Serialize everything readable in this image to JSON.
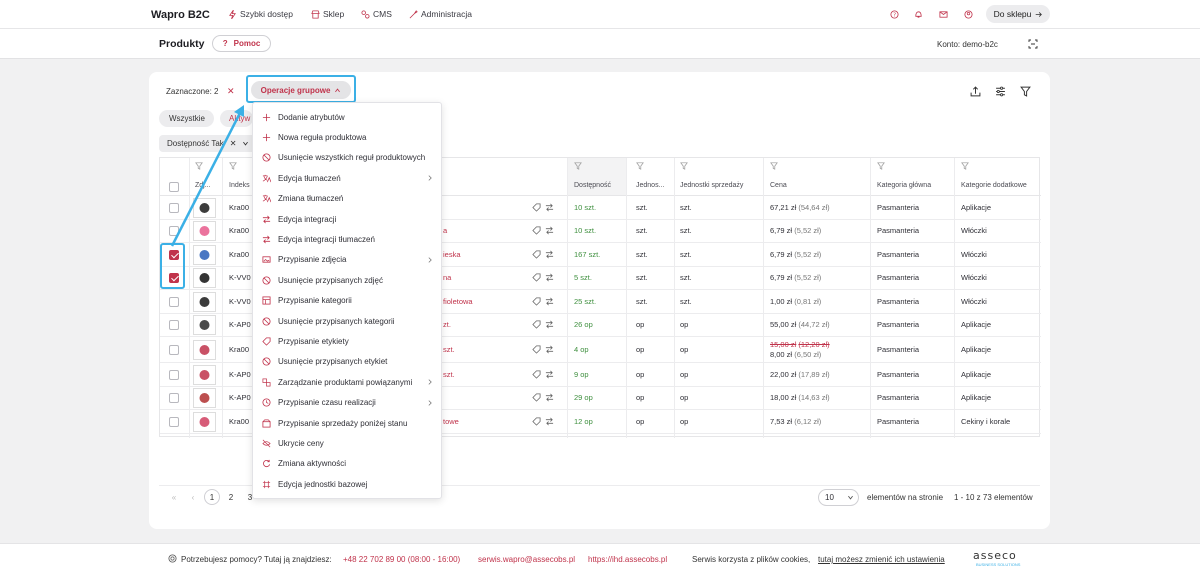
{
  "topbar": {
    "brand": "Wapro B2C",
    "nav": [
      {
        "label": "Szybki dostęp",
        "icon": "bolt-icon"
      },
      {
        "label": "Sklep",
        "icon": "store-icon"
      },
      {
        "label": "CMS",
        "icon": "cms-icon"
      },
      {
        "label": "Administracja",
        "icon": "wrench-icon"
      }
    ],
    "shop_button": "Do sklepu"
  },
  "subbar": {
    "title": "Produkty",
    "help_label": "Pomoc",
    "account": "Konto: demo-b2c"
  },
  "toolbar": {
    "selected": "Zaznaczone: 2",
    "group_ops": "Operacje grupowe"
  },
  "chips": {
    "all": "Wszystkie",
    "active_partial": "Aktyw"
  },
  "filter_chip": "Dostępność Tak",
  "columns": {
    "img": "Zdj...",
    "index": "Indeks",
    "availability": "Dostępność",
    "unit": "Jednos...",
    "sales_unit": "Jednostki sprzedaży",
    "price": "Cena",
    "main_category": "Kategoria główna",
    "extra_categories": "Kategorie dodatkowe"
  },
  "rows": [
    {
      "index": "Kra00",
      "name_tail": "",
      "avail": "10 szt.",
      "unit": "szt.",
      "sunit": "szt.",
      "price": "67,21 zł",
      "net": "(54,64 zł)",
      "old_price": "",
      "old_net": "",
      "main": "Pasmanteria",
      "extra": "Aplikacje",
      "checked": false
    },
    {
      "index": "Kra00",
      "name_tail": "a",
      "avail": "10 szt.",
      "unit": "szt.",
      "sunit": "szt.",
      "price": "6,79 zł",
      "net": "(5,52 zł)",
      "old_price": "",
      "old_net": "",
      "main": "Pasmanteria",
      "extra": "Włóczki",
      "checked": false
    },
    {
      "index": "Kra00",
      "name_tail": "ieska",
      "avail": "167 szt.",
      "unit": "szt.",
      "sunit": "szt.",
      "price": "6,79 zł",
      "net": "(5,52 zł)",
      "old_price": "",
      "old_net": "",
      "main": "Pasmanteria",
      "extra": "Włóczki",
      "checked": true
    },
    {
      "index": "K-VV0",
      "name_tail": "na",
      "avail": "5 szt.",
      "unit": "szt.",
      "sunit": "szt.",
      "price": "6,79 zł",
      "net": "(5,52 zł)",
      "old_price": "",
      "old_net": "",
      "main": "Pasmanteria",
      "extra": "Włóczki",
      "checked": true
    },
    {
      "index": "K-VV0",
      "name_tail": "fioletowa",
      "avail": "25 szt.",
      "unit": "szt.",
      "sunit": "szt.",
      "price": "1,00 zł",
      "net": "(0,81 zł)",
      "old_price": "",
      "old_net": "",
      "main": "Pasmanteria",
      "extra": "Włóczki",
      "checked": false
    },
    {
      "index": "K-AP0",
      "name_tail": "zt.",
      "avail": "26 op",
      "unit": "op",
      "sunit": "op",
      "price": "55,00 zł",
      "net": "(44,72 zł)",
      "old_price": "",
      "old_net": "",
      "main": "Pasmanteria",
      "extra": "Aplikacje",
      "checked": false
    },
    {
      "index": "Kra00",
      "name_tail": "szt.",
      "avail": "4 op",
      "unit": "op",
      "sunit": "op",
      "price": "8,00 zł",
      "net": "(6,50 zł)",
      "old_price": "15,00 zł",
      "old_net": "(12,20 zł)",
      "main": "Pasmanteria",
      "extra": "Aplikacje",
      "checked": false
    },
    {
      "index": "K-AP0",
      "name_tail": "szt.",
      "avail": "9 op",
      "unit": "op",
      "sunit": "op",
      "price": "22,00 zł",
      "net": "(17,89 zł)",
      "old_price": "",
      "old_net": "",
      "main": "Pasmanteria",
      "extra": "Aplikacje",
      "checked": false
    },
    {
      "index": "K-AP0",
      "name_tail": "",
      "avail": "29 op",
      "unit": "op",
      "sunit": "op",
      "price": "18,00 zł",
      "net": "(14,63 zł)",
      "old_price": "",
      "old_net": "",
      "main": "Pasmanteria",
      "extra": "Aplikacje",
      "checked": false
    },
    {
      "index": "Kra00",
      "name_tail": "towe",
      "avail": "12 op",
      "unit": "op",
      "sunit": "op",
      "price": "7,53 zł",
      "net": "(6,12 zł)",
      "old_price": "",
      "old_net": "",
      "main": "Pasmanteria",
      "extra": "Cekiny i korale",
      "checked": false
    }
  ],
  "menu": [
    {
      "label": "Dodanie atrybutów",
      "icon": "plus-icon",
      "sub": false
    },
    {
      "label": "Nowa reguła produktowa",
      "icon": "plus-icon",
      "sub": false
    },
    {
      "label": "Usunięcie wszystkich reguł produktowych",
      "icon": "ban-icon",
      "sub": false
    },
    {
      "label": "Edycja tłumaczeń",
      "icon": "translate-icon",
      "sub": true
    },
    {
      "label": "Zmiana tłumaczeń",
      "icon": "translate-icon",
      "sub": false
    },
    {
      "label": "Edycja integracji",
      "icon": "arrows-icon",
      "sub": false
    },
    {
      "label": "Edycja integracji tłumaczeń",
      "icon": "arrows-icon",
      "sub": false
    },
    {
      "label": "Przypisanie zdjęcia",
      "icon": "image-icon",
      "sub": true
    },
    {
      "label": "Usunięcie przypisanych zdjęć",
      "icon": "ban-icon",
      "sub": false
    },
    {
      "label": "Przypisanie kategorii",
      "icon": "category-icon",
      "sub": false
    },
    {
      "label": "Usunięcie przypisanych kategorii",
      "icon": "ban-icon",
      "sub": false
    },
    {
      "label": "Przypisanie etykiety",
      "icon": "tag-icon",
      "sub": false
    },
    {
      "label": "Usunięcie przypisanych etykiet",
      "icon": "ban-icon",
      "sub": false
    },
    {
      "label": "Zarządzanie produktami powiązanymi",
      "icon": "link-icon",
      "sub": true
    },
    {
      "label": "Przypisanie czasu realizacji",
      "icon": "clock-icon",
      "sub": true
    },
    {
      "label": "Przypisanie sprzedaży poniżej stanu",
      "icon": "stock-icon",
      "sub": false
    },
    {
      "label": "Ukrycie ceny",
      "icon": "eye-off-icon",
      "sub": false
    },
    {
      "label": "Zmiana aktywności",
      "icon": "refresh-icon",
      "sub": false
    },
    {
      "label": "Edycja jednostki bazowej",
      "icon": "unit-icon",
      "sub": false
    }
  ],
  "pager": {
    "pages": [
      "1",
      "2",
      "3"
    ],
    "page_size": "10",
    "per_page_label": "elementów na stronie",
    "range": "1 - 10 z 73 elementów"
  },
  "footer": {
    "help": "Potrzebujesz pomocy? Tutaj ją znajdziesz:",
    "phone": "+48 22 702 89 00 (08:00 - 16:00)",
    "email": "serwis.wapro@assecobs.pl",
    "url": "https://ihd.assecobs.pl",
    "cookies": "Serwis korzysta z plików cookies,",
    "cookies_link": "tutaj możesz zmienić ich ustawienia",
    "logo": "asseco",
    "logo_sub": "BUSINESS SOLUTIONS"
  },
  "colors": {
    "accent": "#c0334b",
    "highlight": "#3bb0e6",
    "available": "#3e8f3e"
  }
}
